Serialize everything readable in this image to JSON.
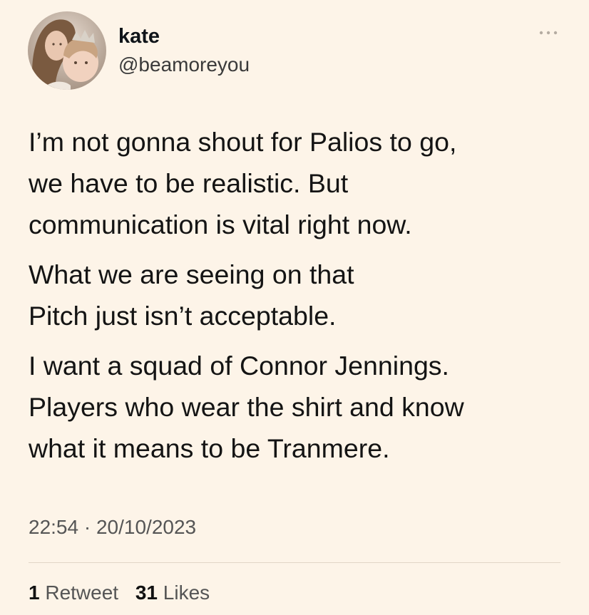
{
  "author": {
    "name": "kate",
    "handle": "@beamoreyou",
    "avatar_icon": "profile-photo"
  },
  "more_icon": "more-horizontal-icon",
  "tweet": {
    "paragraphs": [
      "I’m not gonna shout for Palios to go,\nwe have to be realistic. But\ncommunication is vital right now.",
      "What we are seeing on that\nPitch just isn’t acceptable.",
      "I want a squad of Connor Jennings.\nPlayers who wear the shirt and know\nwhat it means to be Tranmere."
    ],
    "time": "22:54",
    "separator": "·",
    "date": "20/10/2023"
  },
  "stats": {
    "retweets_count": "1",
    "retweets_label": "Retweet",
    "likes_count": "31",
    "likes_label": "Likes"
  },
  "colors": {
    "background": "#fdf4e8",
    "text": "#141414",
    "secondary_text": "#555555",
    "divider": "#e2d6c6"
  }
}
